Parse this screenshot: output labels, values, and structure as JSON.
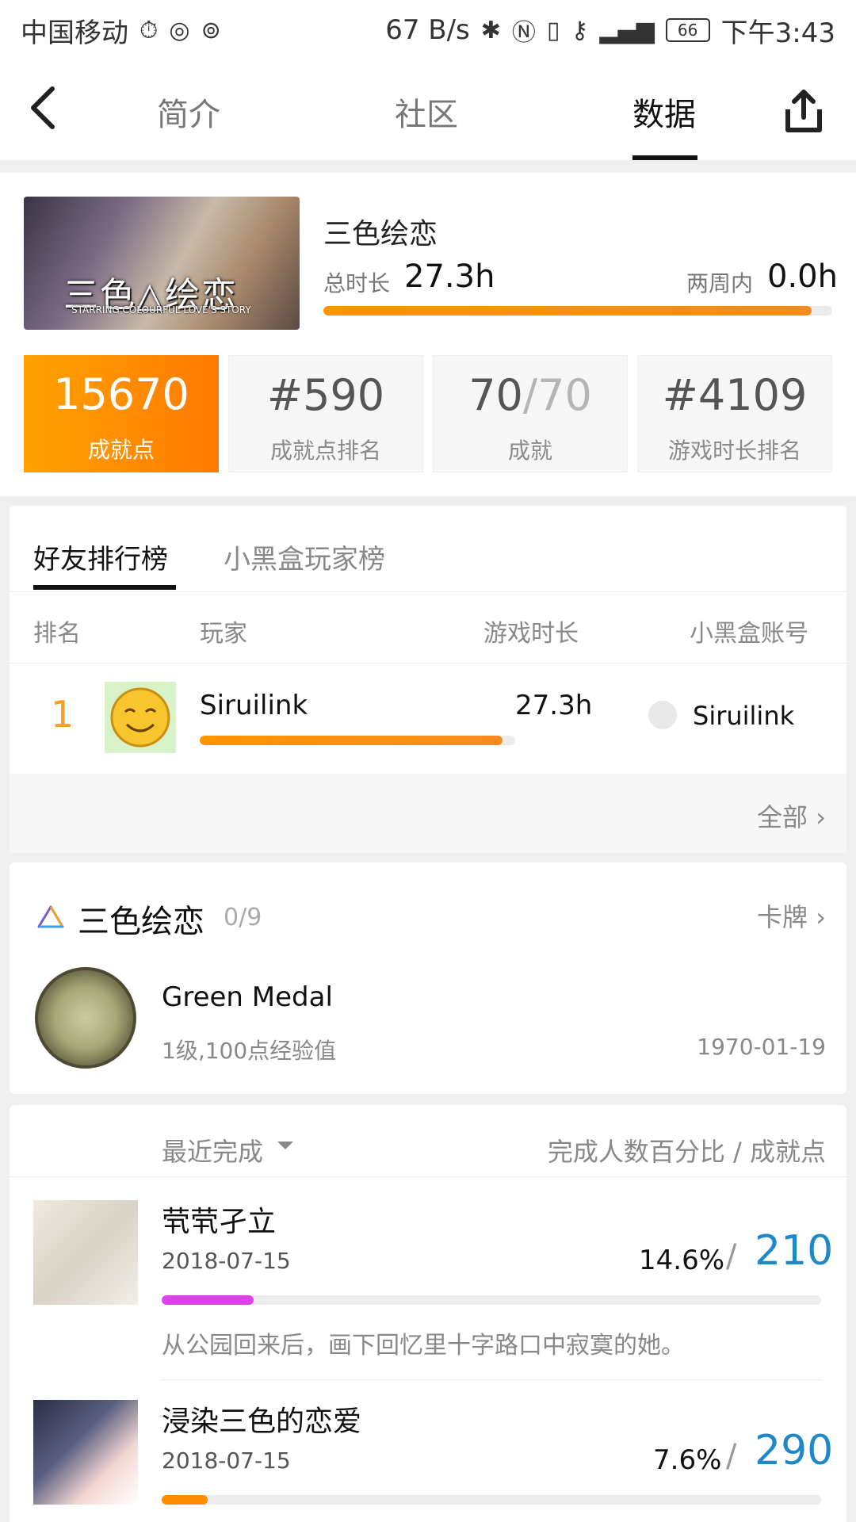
{
  "status_bar": {
    "carrier": "中国移动",
    "speed": "67 B/s",
    "battery": "66",
    "time": "下午3:43"
  },
  "nav": {
    "tabs": [
      {
        "label": "简介"
      },
      {
        "label": "社区"
      },
      {
        "label": "数据"
      }
    ],
    "active_tab": "数据"
  },
  "game": {
    "title": "三色绘恋",
    "cover_logo": "三色△绘恋",
    "cover_sub": "STARRING COLOURFUL LOVE'S STORY",
    "total_label": "总时长",
    "total_value": "27.3h",
    "two_weeks_label": "两周内",
    "two_weeks_value": "0.0h",
    "playtime_progress": 0.96
  },
  "stats": [
    {
      "value": "15670",
      "label": "成就点"
    },
    {
      "value": "#590",
      "label": "成就点排名"
    },
    {
      "value_a": "70",
      "value_b": "/70",
      "label": "成就"
    },
    {
      "value": "#4109",
      "label": "游戏时长排名"
    }
  ],
  "ranking": {
    "tabs": [
      "好友排行榜",
      "小黑盒玩家榜"
    ],
    "columns": [
      "排名",
      "玩家",
      "游戏时长",
      "小黑盒账号"
    ],
    "rows": [
      {
        "rank": "1",
        "player": "Siruilink",
        "time": "27.3h",
        "progress": 0.96,
        "account": "Siruilink"
      }
    ],
    "all_label": "全部"
  },
  "achievement_card": {
    "title": "三色绘恋",
    "count": "0/9",
    "link": "卡牌",
    "medal_name": "Green Medal",
    "medal_desc": "1级,100点经验值",
    "medal_date": "1970-01-19"
  },
  "achievements": {
    "sort_label": "最近完成",
    "right_label": "完成人数百分比 / 成就点",
    "items": [
      {
        "title": "茕茕孑立",
        "date": "2018-07-15",
        "percent": "14.6%",
        "points": "210",
        "progress": 0.14,
        "color": "#e040e8",
        "desc": "从公园回来后，画下回忆里十字路口中寂寞的她。"
      },
      {
        "title": "浸染三色的恋爱",
        "date": "2018-07-15",
        "percent": "7.6%",
        "points": "290",
        "progress": 0.07,
        "color": "#ff8c00"
      }
    ]
  },
  "icons": [
    "stopwatch-icon",
    "camera-lens-icon",
    "swirl-icon",
    "bluetooth-icon",
    "nfc-icon",
    "vibrate-icon",
    "key-icon",
    "signal-icon",
    "battery-icon",
    "back-arrow-icon",
    "share-icon",
    "chevron-right-icon",
    "triangle-logo-icon",
    "caret-down-icon"
  ],
  "colors": {
    "accent_orange": "#ff8c00",
    "points_blue": "#1f88c8",
    "rank_gold": "#f5a21d"
  }
}
